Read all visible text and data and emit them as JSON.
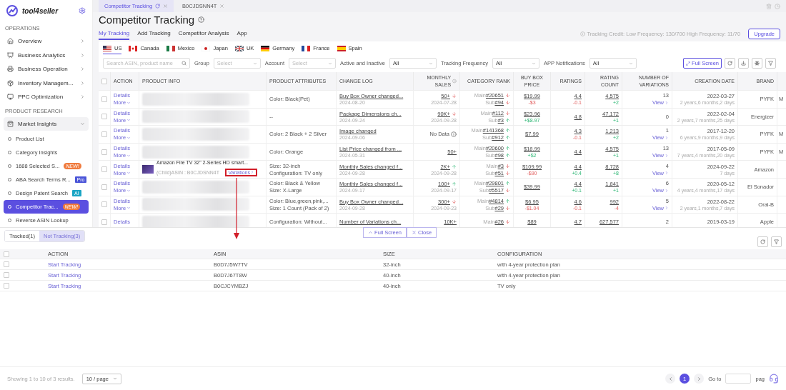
{
  "tabs": [
    {
      "label": "Competitor Tracking",
      "selected": true,
      "refresh": true
    },
    {
      "label": "B0CJDSNN4T",
      "selected": false,
      "refresh": false
    }
  ],
  "sidebar": {
    "brand": "tool4seller",
    "sections": [
      {
        "title": "OPERATIONS",
        "items": [
          {
            "label": "Overview",
            "expanded": false
          },
          {
            "label": "Business Analytics",
            "expanded": false
          },
          {
            "label": "Business Operation",
            "expanded": false
          },
          {
            "label": "Inventory Managem...",
            "expanded": false
          },
          {
            "label": "PPC Optimization",
            "expanded": false
          }
        ]
      },
      {
        "title": "PRODUCT RESEARCH",
        "items": [
          {
            "label": "Market Insights",
            "expanded": true,
            "children": [
              {
                "label": "Product List",
                "selected": false
              },
              {
                "label": "Category Insights",
                "selected": false
              },
              {
                "label": "1688 Selected S...",
                "selected": false,
                "badge": {
                  "text": "NEW!",
                  "kind": "new"
                }
              },
              {
                "label": "ABA Search Terms R...",
                "selected": false,
                "badge": {
                  "text": "Pro",
                  "kind": "pro"
                }
              },
              {
                "label": "Design Patent Search",
                "selected": false,
                "badge": {
                  "text": "AI",
                  "kind": "ai"
                }
              },
              {
                "label": "Competitor Trac...",
                "selected": true,
                "badge": {
                  "text": "NEW!",
                  "kind": "new"
                }
              },
              {
                "label": "Reverse ASIN Lookup",
                "selected": false
              }
            ]
          }
        ]
      }
    ]
  },
  "page": {
    "title": "Competitor Tracking",
    "subtabs": [
      {
        "label": "My Tracking",
        "selected": true
      },
      {
        "label": "Add Tracking",
        "selected": false
      },
      {
        "label": "Competitor Analysis",
        "selected": false
      },
      {
        "label": "App",
        "selected": false
      }
    ],
    "credit": "Tracking Credit: Low Frequency: 130/700 High Frequency: 11/70",
    "upgrade": "Upgrade",
    "countries": [
      {
        "label": "US",
        "selected": true
      },
      {
        "label": "Canada",
        "selected": false
      },
      {
        "label": "Mexico",
        "selected": false
      },
      {
        "label": "Japan",
        "selected": false
      },
      {
        "label": "UK",
        "selected": false
      },
      {
        "label": "Germany",
        "selected": false
      },
      {
        "label": "France",
        "selected": false
      },
      {
        "label": "Spain",
        "selected": false
      }
    ],
    "search": {
      "placeholder": "Search ASIN, product name"
    },
    "filters": [
      {
        "label": "Group",
        "placeholder": "Select"
      },
      {
        "label": "Account",
        "placeholder": "Select"
      },
      {
        "label": "Active and Inactive",
        "value": "All"
      },
      {
        "label": "Tracking Frequency",
        "value": "All"
      },
      {
        "label": "APP Notifications",
        "value": "All"
      }
    ],
    "full_screen": "Full Screen"
  },
  "table": {
    "all_checked": false,
    "columns": [
      {
        "label": "ACTION"
      },
      {
        "label": "PRODUCT INFO"
      },
      {
        "label": "PRODUCT ATTRIBUTES"
      },
      {
        "label": "CHANGE LOG"
      },
      {
        "label": "MONTHLY SALES",
        "info": true
      },
      {
        "label": "CATEGORY RANK"
      },
      {
        "label": "BUY BOX PRICE"
      },
      {
        "label": "RATINGS"
      },
      {
        "label": "RATING COUNT"
      },
      {
        "label": "NUMBER OF VARIATIONS"
      },
      {
        "label": "CREATION DATE"
      },
      {
        "label": "BRAND"
      }
    ],
    "rows": [
      {
        "checked": false,
        "actions": [
          "Details",
          "More"
        ],
        "product": {
          "kind": "blurred"
        },
        "attributes": [
          "Color: Black(Pet)"
        ],
        "log": {
          "text": "Buy Box Owner changed...",
          "date": "2024-08-20"
        },
        "sales": {
          "kind": "link",
          "value": "50+",
          "up": false,
          "date": "2024-07-28"
        },
        "rank": [
          {
            "label": "Main",
            "value": "#20651",
            "up": false
          },
          {
            "label": "Sub",
            "value": "#94",
            "up": false
          }
        ],
        "price": {
          "value": "$19.99",
          "change": "-$3",
          "up": false
        },
        "rating": {
          "value": "4.4",
          "change": "-0.1",
          "up": false
        },
        "count": {
          "value": "4,575",
          "change": "+2",
          "up": true
        },
        "variations": {
          "value": "13",
          "link": "View"
        },
        "created": {
          "date": "2022-03-27",
          "age": "2 years,6 months,2 days"
        },
        "brand": "PYFK",
        "column_13": "M"
      },
      {
        "checked": false,
        "actions": [
          "Details",
          "More"
        ],
        "product": {
          "kind": "blurred"
        },
        "attributes": [
          "--"
        ],
        "log": {
          "text": "Package Dimensions ch...",
          "date": "2024-09-24"
        },
        "sales": {
          "kind": "link",
          "value": "90K+",
          "up": false,
          "date": "2024-09-28"
        },
        "rank": [
          {
            "label": "Main",
            "value": "#112",
            "up": false
          },
          {
            "label": "Sub",
            "value": "#3",
            "up": true
          }
        ],
        "price": {
          "value": "$23.96",
          "change": "+$8.97",
          "up": true
        },
        "rating": {
          "value": "4.8"
        },
        "count": {
          "value": "47,172",
          "change": "+1",
          "up": true
        },
        "variations": {
          "value": "0"
        },
        "created": {
          "date": "2022-02-04",
          "age": "2 years,7 months,25 days"
        },
        "brand": "Energizer"
      },
      {
        "checked": false,
        "actions": [
          "Details",
          "More"
        ],
        "product": {
          "kind": "blurred"
        },
        "attributes": [
          "Color: 2 Black + 2 Silver"
        ],
        "log": {
          "text": "Image changed",
          "date": "2024-09-06"
        },
        "sales": {
          "kind": "empty",
          "value": "No Data"
        },
        "rank": [
          {
            "label": "Main",
            "value": "#141368",
            "up": true
          },
          {
            "label": "Sub",
            "value": "#912",
            "up": true
          }
        ],
        "price": {
          "value": "$7.99"
        },
        "rating": {
          "value": "4.3",
          "change": "-0.1",
          "up": false
        },
        "count": {
          "value": "1,213",
          "change": "+2",
          "up": true
        },
        "variations": {
          "value": "1",
          "link": "View"
        },
        "created": {
          "date": "2017-12-20",
          "age": "6 years,9 months,9 days"
        },
        "brand": "PYFK",
        "column_13": "M"
      },
      {
        "checked": false,
        "actions": [
          "Details",
          "More"
        ],
        "product": {
          "kind": "blurred"
        },
        "attributes": [
          "Color: Orange"
        ],
        "log": {
          "text": "List Price changed from ...",
          "date": "2024-05-31"
        },
        "sales": {
          "kind": "link",
          "value": "50+"
        },
        "rank": [
          {
            "label": "Main",
            "value": "#20600",
            "up": true
          },
          {
            "label": "Sub",
            "value": "#98",
            "up": true
          }
        ],
        "price": {
          "value": "$18.99",
          "change": "+$2",
          "up": true
        },
        "rating": {
          "value": "4.4"
        },
        "count": {
          "value": "4,575",
          "change": "+1",
          "up": true
        },
        "variations": {
          "value": "13",
          "link": "View"
        },
        "created": {
          "date": "2017-05-09",
          "age": "7 years,4 months,20 days"
        },
        "brand": "PYFK",
        "column_13": "M"
      },
      {
        "checked": false,
        "actions": [
          "Details",
          "More"
        ],
        "product": {
          "kind": "item",
          "title": "Amazon Fire TV 32\" 2-Series HD smart...",
          "asin": "(Child)ASIN : B0CJDSNN4T",
          "link": "Variations",
          "highlighted": true
        },
        "attributes": [
          "Size: 32-inch",
          "Configuration: TV only"
        ],
        "log": {
          "text": "Monthly Sales changed f...",
          "date": "2024-09-28"
        },
        "sales": {
          "kind": "link",
          "value": "2K+",
          "up": true,
          "date": "2024-09-28"
        },
        "rank": [
          {
            "label": "Main",
            "value": "#3",
            "up": false
          },
          {
            "label": "Sub",
            "value": "#51",
            "up": false
          }
        ],
        "price": {
          "value": "$109.99",
          "change": "-$90",
          "up": false
        },
        "rating": {
          "value": "4.4",
          "change": "+0.4",
          "up": true
        },
        "count": {
          "value": "8,728",
          "change": "+8",
          "up": true
        },
        "variations": {
          "value": "4",
          "link": "View"
        },
        "created": {
          "date": "2024-09-22",
          "age": "7 days"
        },
        "brand": "Amazon"
      },
      {
        "checked": false,
        "actions": [
          "Details",
          "More"
        ],
        "product": {
          "kind": "blurred"
        },
        "attributes": [
          "Color: Black & Yellow",
          "Size: X-Large"
        ],
        "log": {
          "text": "Monthly Sales changed f...",
          "date": "2024-09-17"
        },
        "sales": {
          "kind": "link",
          "value": "100+",
          "up": true,
          "date": "2024-09-17"
        },
        "rank": [
          {
            "label": "Main",
            "value": "#29801",
            "up": true
          },
          {
            "label": "Sub",
            "value": "#5517",
            "up": false
          }
        ],
        "price": {
          "value": "$39.99"
        },
        "rating": {
          "value": "4.4",
          "change": "+0.1",
          "up": true
        },
        "count": {
          "value": "1,841",
          "change": "+1",
          "up": true
        },
        "variations": {
          "value": "6",
          "link": "View"
        },
        "created": {
          "date": "2020-05-12",
          "age": "4 years,4 months,17 days"
        },
        "brand": "El Sonador"
      },
      {
        "checked": false,
        "actions": [
          "Details",
          "More"
        ],
        "product": {
          "kind": "blurred"
        },
        "attributes": [
          "Color: Blue,green,pink,...",
          "Size: 1 Count (Pack of 2)"
        ],
        "log": {
          "text": "Buy Box Owner changed...",
          "date": "2024-09-28"
        },
        "sales": {
          "kind": "link",
          "value": "300+",
          "up": false,
          "date": "2024-09-23"
        },
        "rank": [
          {
            "label": "Main",
            "value": "#4814",
            "up": true
          },
          {
            "label": "Sub",
            "value": "#29",
            "up": false
          }
        ],
        "price": {
          "value": "$6.95",
          "change": "-$1.04",
          "up": false
        },
        "rating": {
          "value": "4.6",
          "change": "-0.1",
          "up": false
        },
        "count": {
          "value": "992",
          "change": "-4",
          "up": false
        },
        "variations": {
          "value": "5",
          "link": "View"
        },
        "created": {
          "date": "2022-08-22",
          "age": "2 years,1 months,7 days"
        },
        "brand": "Oral-B"
      },
      {
        "checked": false,
        "actions": [
          "Details"
        ],
        "product": {
          "kind": "blurred"
        },
        "attributes": [
          "Configuration: Without..."
        ],
        "log": {
          "text": "Number of Variations ch..."
        },
        "sales": {
          "kind": "link",
          "value": "10K+"
        },
        "rank": [
          {
            "label": "Main",
            "value": "#26",
            "up": false
          }
        ],
        "price": {
          "value": "$89"
        },
        "rating": {
          "value": "4.7"
        },
        "count": {
          "value": "627,577"
        },
        "variations": {
          "value": "2"
        },
        "created": {
          "date": "2019-03-19"
        },
        "brand": "Apple"
      }
    ]
  },
  "panel": {
    "all_checked": false,
    "tabs": [
      {
        "label": "Tracked(1)",
        "selected": false
      },
      {
        "label": "Not Tracking(3)",
        "selected": true
      }
    ],
    "buttons": [
      {
        "label": "Full Screen",
        "kind": "expand"
      },
      {
        "label": "Close",
        "kind": "close"
      }
    ],
    "columns": [
      "ACTION",
      "ASIN",
      "SIZE",
      "CONFIGURATION"
    ],
    "rows": [
      {
        "checked": false,
        "action": "Start Tracking",
        "asin": "B0D7J5W7TV",
        "size": "32-inch",
        "configuration": "with 4-year protection plan"
      },
      {
        "checked": false,
        "action": "Start Tracking",
        "asin": "B0D7J67T8W",
        "size": "40-inch",
        "configuration": "with 4-year protection plan"
      },
      {
        "checked": false,
        "action": "Start Tracking",
        "asin": "B0CJCYMBZJ",
        "size": "40-inch",
        "configuration": "TV only"
      }
    ],
    "footer": {
      "summary": "Showing 1 to 10 of 3 results.",
      "page_size": "10 / page",
      "pages": [
        {
          "label": "1",
          "selected": true
        }
      ],
      "goto": "Go to",
      "page_suffix": "pag"
    }
  }
}
